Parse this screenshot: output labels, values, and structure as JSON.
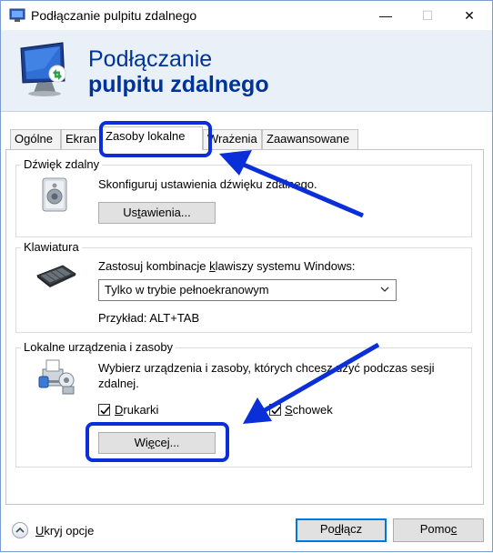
{
  "titlebar": {
    "title": "Podłączanie pulpitu zdalnego",
    "minimize_glyph": "—",
    "maximize_glyph": "☐",
    "close_glyph": "✕"
  },
  "banner": {
    "line1": "Podłączanie",
    "line2": "pulpitu zdalnego",
    "icon": "remote-desktop-monitor-icon"
  },
  "tabs": [
    {
      "label": "Ogólne",
      "active": false
    },
    {
      "label": "Ekran",
      "active": false
    },
    {
      "label": "Zasoby lokalne",
      "active": true
    },
    {
      "label": "Wrażenia",
      "active": false
    },
    {
      "label": "Zaawansowane",
      "active": false
    }
  ],
  "audio": {
    "group_label": "Dźwięk zdalny",
    "description": "Skonfiguruj ustawienia dźwięku zdalnego.",
    "button_pre": "Us",
    "button_acc": "t",
    "button_post": "awienia...",
    "icon": "speaker-icon"
  },
  "keyboard": {
    "group_label": "Klawiatura",
    "description_pre": "Zastosuj kombinacje ",
    "description_acc": "k",
    "description_post": "lawiszy systemu Windows:",
    "selected": "Tylko w trybie pełnoekranowym",
    "example": "Przykład: ALT+TAB",
    "icon": "keyboard-icon"
  },
  "devices": {
    "group_label": "Lokalne urządzenia i zasoby",
    "description_line1": "Wybierz urządzenia i zasoby, których chcesz użyć podczas sesji",
    "description_line2": "zdalnej.",
    "printers_acc": "D",
    "printers_post": "rukarki",
    "printers_checked": true,
    "clipboard_acc": "S",
    "clipboard_post": "chowek",
    "clipboard_checked": true,
    "more_pre": "Wi",
    "more_acc": "ę",
    "more_post": "cej...",
    "icon": "printer-devices-icon"
  },
  "footer": {
    "hide_acc": "U",
    "hide_post": "kryj opcje",
    "connect_pre": "Po",
    "connect_acc": "d",
    "connect_post": "łącz",
    "help_pre": "Pomo",
    "help_acc": "c"
  },
  "colors": {
    "accent": "#003399",
    "annotation": "#0a2fd9",
    "banner_bg": "#e9f0f8",
    "focus": "#0078d7"
  }
}
